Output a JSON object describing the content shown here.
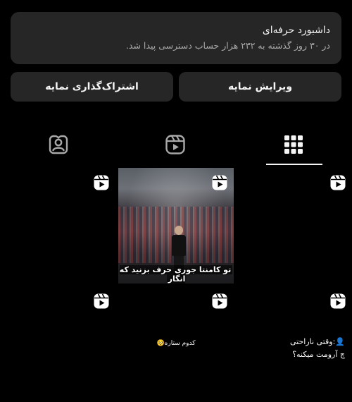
{
  "dashboard": {
    "title": "داشبورد حرفه‌ای",
    "subtitle": "در ۳۰ روز گذشته به ۲۳۲ هزار حساب دسترسی پیدا شد."
  },
  "buttons": {
    "edit_profile": "ویرایش نمایه",
    "share_profile": "اشتراک‌گذاری نمایه"
  },
  "tabs": {
    "active": "grid",
    "items": [
      "grid-icon",
      "reels-icon",
      "tagged-icon"
    ]
  },
  "grid": {
    "posts": [
      {
        "type": "reel",
        "caption": ""
      },
      {
        "type": "reel",
        "caption_line1": "تو کامنتا جوری حرف بزنید که انگار",
        "caption_line2": "...",
        "image": "football-player-in-stadium"
      },
      {
        "type": "reel",
        "caption": ""
      },
      {
        "type": "reel",
        "caption": ""
      },
      {
        "type": "reel",
        "caption": "کدوم ستاره🥺"
      },
      {
        "type": "reel",
        "caption_line1": "👤:وقتی ناراحتی",
        "caption_line2": "چ آرومت میکنه؟"
      }
    ]
  },
  "colors": {
    "background": "#000000",
    "card": "#262626",
    "text_primary": "#f5f5f5",
    "text_secondary": "#a8a8a8"
  }
}
